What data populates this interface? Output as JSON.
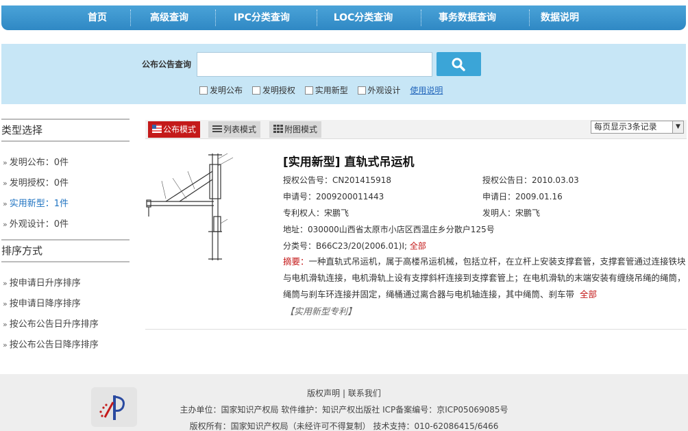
{
  "nav": {
    "items": [
      "首页",
      "高级查询",
      "IPC分类查询",
      "LOC分类查询",
      "事务数据查询",
      "数据说明"
    ]
  },
  "search": {
    "label": "公布公告查询",
    "value": "",
    "filters": [
      "发明公布",
      "发明授权",
      "实用新型",
      "外观设计"
    ],
    "help_link": "使用说明"
  },
  "sidebar": {
    "type_heading": "类型选择",
    "type_items": [
      "发明公布：0件",
      "发明授权：0件",
      "实用新型：1件",
      "外观设计：0件"
    ],
    "sort_heading": "排序方式",
    "sort_items": [
      "按申请日升序排序",
      "按申请日降序排序",
      "按公布公告日升序排序",
      "按公布公告日降序排序"
    ]
  },
  "toolbar": {
    "modes": [
      "公布模式",
      "列表模式",
      "附图模式"
    ],
    "per_page": "每页显示3条记录"
  },
  "result": {
    "title": "[实用新型] 直轨式吊运机",
    "grant_no": "授权公告号：CN201415918",
    "grant_date": "授权公告日：2010.03.03",
    "app_no": "申请号：2009200011443",
    "app_date": "申请日：2009.01.16",
    "patentee": "专利权人：宋鹏飞",
    "inventor": "发明人：宋鹏飞",
    "address": "地址：030000山西省太原市小店区西温庄乡分散户125号",
    "class_no": "分类号：B66C23/20(2006.01)I;",
    "class_all": "全部",
    "abstract_label": "摘要：",
    "abstract_text": "一种直轨式吊运机，属于高楼吊运机械，包括立杆，在立杆上安装支撑套管，支撑套管通过连接铁块与电机滑轨连接，电机滑轨上设有支撑斜杆连接到支撑套管上；在电机滑轨的末端安装有缠绕吊绳的绳筒，绳筒与刹车环连接并固定，绳桶通过离合器与电机轴连接，其中绳筒、刹车带",
    "abstract_all": "全部",
    "patent_type": "【实用新型专利】"
  },
  "footer": {
    "links": "版权声明 | 联系我们",
    "line2": "主办单位：国家知识产权局 软件维护：知识产权出版社 ICP备案编号：京ICP05069085号",
    "line3": "版权所有：国家知识产权局（未经许可不得复制） 技术支持：010-62086415/6466"
  },
  "colors": {
    "nav": "#2f88c4",
    "search_band": "#c7e6f6",
    "active_mode": "#c41a1a",
    "active_link": "#1f73c1"
  }
}
